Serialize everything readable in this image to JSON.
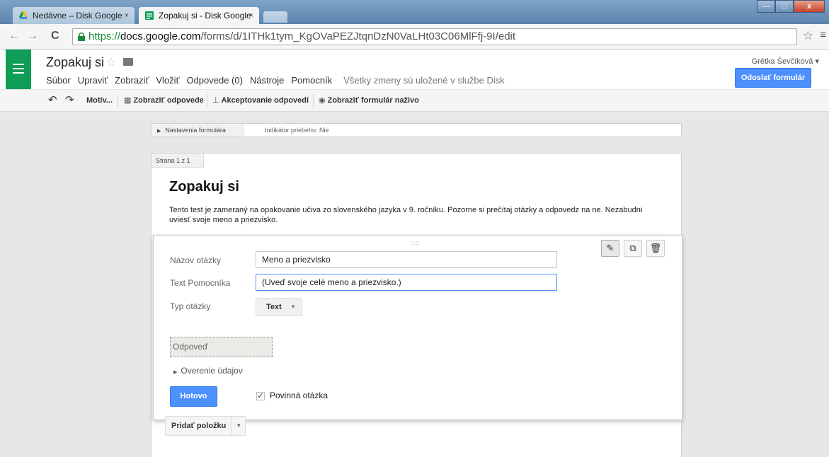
{
  "browser": {
    "tabs": [
      {
        "title": "Nedávne – Disk Google",
        "close": "×"
      },
      {
        "title": "Zopakuj si - Disk Google",
        "close": "×"
      }
    ],
    "window_controls": {
      "minimize": "—",
      "maximize": "□",
      "close": "x"
    },
    "url": {
      "scheme": "https://",
      "host": "docs.google.com",
      "path": "/forms/d/1ITHk1tym_KgOVaPEZJtqnDzN0VaLHt03C06MlFfj-9I/edit"
    },
    "icons": {
      "back": "←",
      "forward": "→",
      "reload": "C",
      "star": "☆",
      "menu": "≡"
    }
  },
  "header": {
    "doc_title": "Zopakuj si",
    "star_glyph": "☆",
    "menu": [
      "Súbor",
      "Upraviť",
      "Zobraziť",
      "Vložiť",
      "Odpovede (0)",
      "Nástroje",
      "Pomocník"
    ],
    "saved_status": "Všetky zmeny sú uložené v službe Disk",
    "user_name": "Grétka Ševčíková ▾",
    "send_button": "Odoslať formulár"
  },
  "edit_toolbar": {
    "undo": "↶",
    "redo": "↷",
    "theme": "Motív...",
    "view_responses": "Zobraziť odpovede",
    "accepting_responses": "Akceptovanie odpovedí",
    "view_live_form": "Zobraziť formulár naživo",
    "icons": {
      "table": "▦",
      "inbox": "⊥",
      "globe": "◉"
    }
  },
  "settings": {
    "tab_label": "Nastavenia formulára",
    "tab_glyph": "▶",
    "progress_indicator": "Indikátor priebehu: Nie"
  },
  "form": {
    "page_label": "Strana 1 z 1",
    "title": "Zopakuj si",
    "description": "Tento test je zameraný na opakovanie učiva zo slovenského jazyka v 9. ročníku. Pozorne si prečítaj otázky a odpovedz na ne. Nezabudni uviesť svoje meno a priezvisko."
  },
  "question": {
    "drag_glyph": "::::",
    "action_icons": {
      "edit": "✎",
      "duplicate": "⧉",
      "delete": "🗑"
    },
    "title_label": "Názov otázky",
    "title_value": "Meno a priezvisko",
    "help_label": "Text Pomocníka",
    "help_value": "(Uveď svoje celé meno a priezvisko.)",
    "type_label": "Typ otázky",
    "type_value": "Text",
    "type_caret": "▼",
    "answer_placeholder": "Odpoveď",
    "validation_label": "Overenie údajov",
    "validation_glyph": "▶",
    "done_button": "Hotovo",
    "required_check": "✓",
    "required_label": "Povinná otázka"
  },
  "add_item": {
    "label": "Pridať položku",
    "caret": "▼"
  },
  "colors": {
    "accent": "#4d90fe",
    "forms_green": "#0f9d58",
    "url_green": "#1a8c3a"
  }
}
